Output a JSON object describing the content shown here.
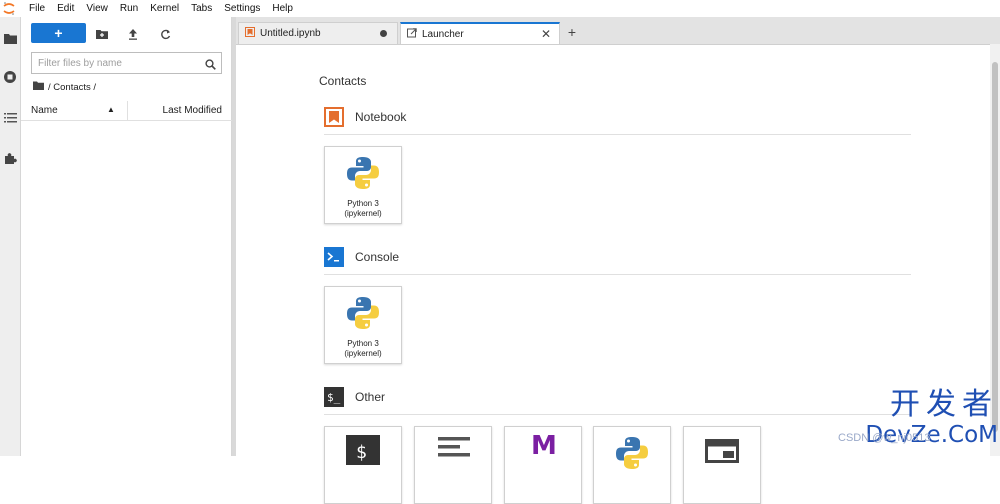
{
  "menubar": {
    "items": [
      "File",
      "Edit",
      "View",
      "Run",
      "Kernel",
      "Tabs",
      "Settings",
      "Help"
    ]
  },
  "file_browser": {
    "new_button_label": "+",
    "filter_placeholder": "Filter files by name",
    "breadcrumb": "/ Contacts /",
    "columns": {
      "name": "Name",
      "last_modified": "Last Modified"
    }
  },
  "tabs": [
    {
      "label": "Untitled.ipynb"
    },
    {
      "label": "Launcher"
    }
  ],
  "launcher": {
    "cwd": "Contacts",
    "sections": {
      "notebook": {
        "title": "Notebook",
        "card_label_1": "Python 3",
        "card_label_2": "(ipykernel)"
      },
      "console": {
        "title": "Console",
        "card_label_1": "Python 3",
        "card_label_2": "(ipykernel)"
      },
      "other": {
        "title": "Other"
      }
    }
  },
  "watermark": {
    "line1": "开发者",
    "line2": "DevZe.CoM",
    "line3": "CSDN @w_nj0513"
  },
  "colors": {
    "accent": "#1976d2",
    "notebook_icon": "#e46e2e",
    "markdown_icon": "#7b1fa2",
    "terminal_icon": "#333333"
  }
}
